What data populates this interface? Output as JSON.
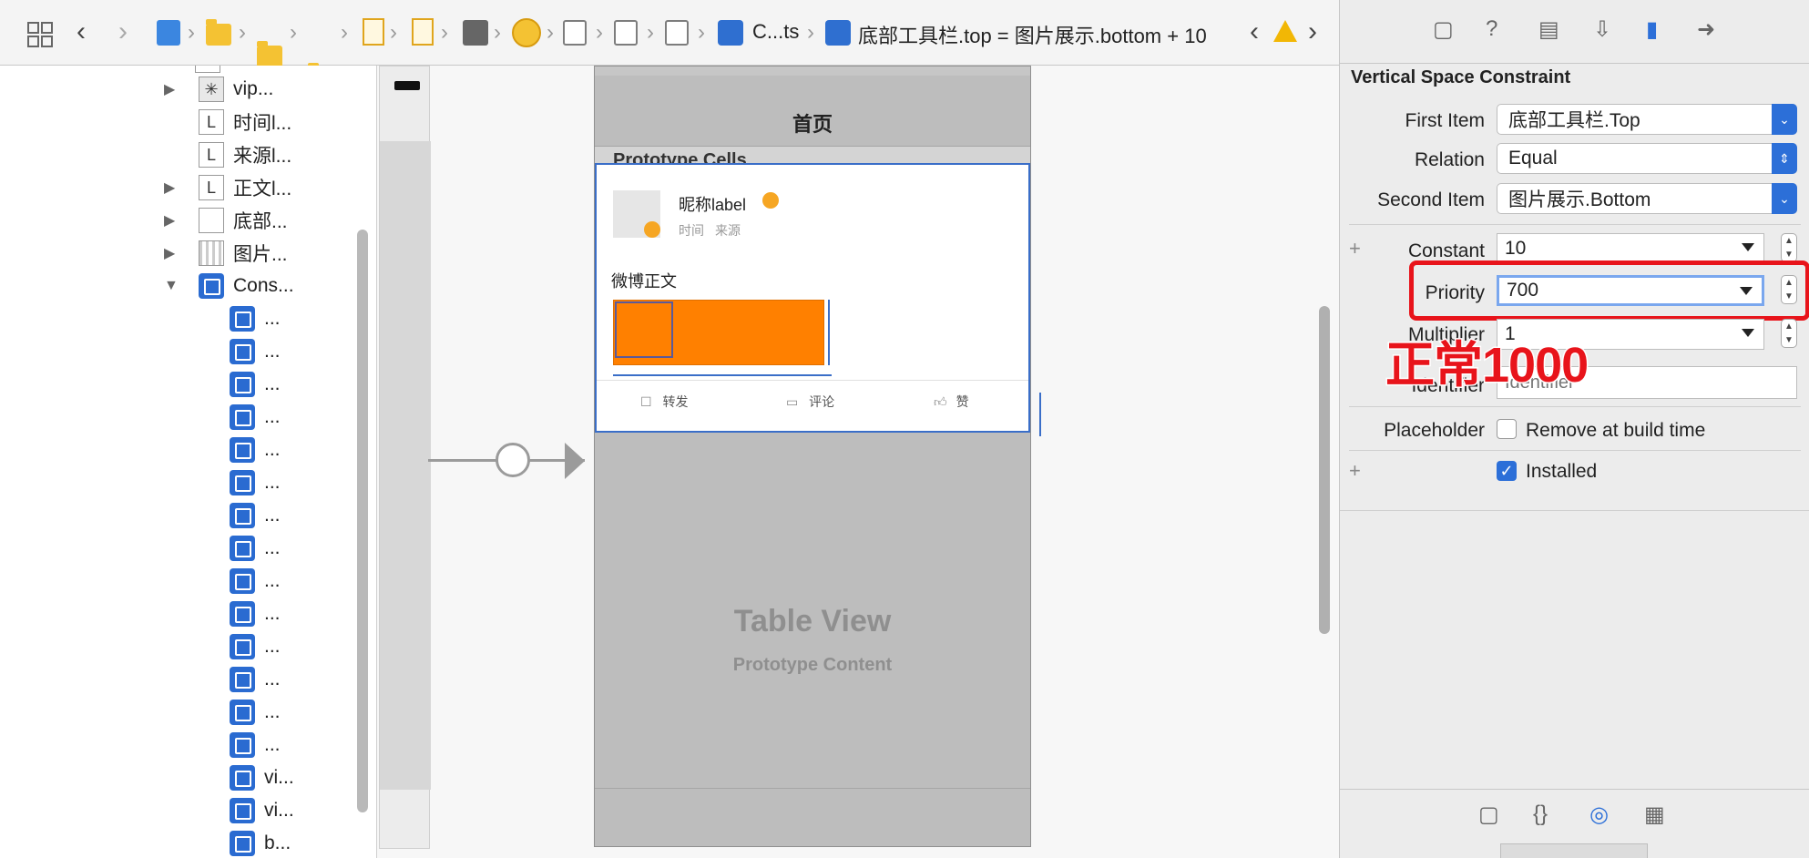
{
  "jumpbar": {
    "crumb_c_ts": "C...ts",
    "crumb_constraint": "底部工具栏.top = 图片展示.bottom + 10"
  },
  "navigator": {
    "items": [
      {
        "label": "vip...",
        "type": "image",
        "disclosure": "▶"
      },
      {
        "label": "时间l...",
        "type": "label"
      },
      {
        "label": "来源l...",
        "type": "label"
      },
      {
        "label": "正文l...",
        "type": "label",
        "disclosure": "▶"
      },
      {
        "label": "底部...",
        "type": "view",
        "disclosure": "▶"
      },
      {
        "label": "图片...",
        "type": "collection",
        "disclosure": "▶"
      },
      {
        "label": "Cons...",
        "type": "constraints",
        "disclosure": "▼"
      }
    ],
    "constraints": [
      "...",
      "...",
      "...",
      "...",
      "...",
      "...",
      "...",
      "...",
      "...",
      "...",
      "...",
      "...",
      "...",
      "...",
      "vi...",
      "vi...",
      "b..."
    ]
  },
  "canvas": {
    "nav_title": "首页",
    "prototype_cells": "Prototype Cells",
    "nickname": "昵称label",
    "time": "时间",
    "source": "来源",
    "body_text": "微博正文",
    "toolbar": {
      "repost": "转发",
      "comment": "评论",
      "like": "赞"
    },
    "table_view_title": "Table View",
    "table_view_subtitle": "Prototype Content",
    "colors": {
      "image_fill": "#ff8000",
      "constraint_blue": "#3a6ec8"
    }
  },
  "inspector": {
    "title": "Vertical Space Constraint",
    "first_item_label": "First Item",
    "first_item_value": "底部工具栏.Top",
    "relation_label": "Relation",
    "relation_value": "Equal",
    "second_item_label": "Second Item",
    "second_item_value": "图片展示.Bottom",
    "constant_label": "Constant",
    "constant_value": "10",
    "priority_label": "Priority",
    "priority_value": "700",
    "multiplier_label": "Multiplier",
    "multiplier_value": "1",
    "identifier_label": "Identifier",
    "identifier_placeholder": "Identifier",
    "placeholder_label": "Placeholder",
    "remove_at_build_label": "Remove at build time",
    "installed_label": "Installed",
    "annotation": "正常1000",
    "highlight_color": "#e8141b"
  }
}
